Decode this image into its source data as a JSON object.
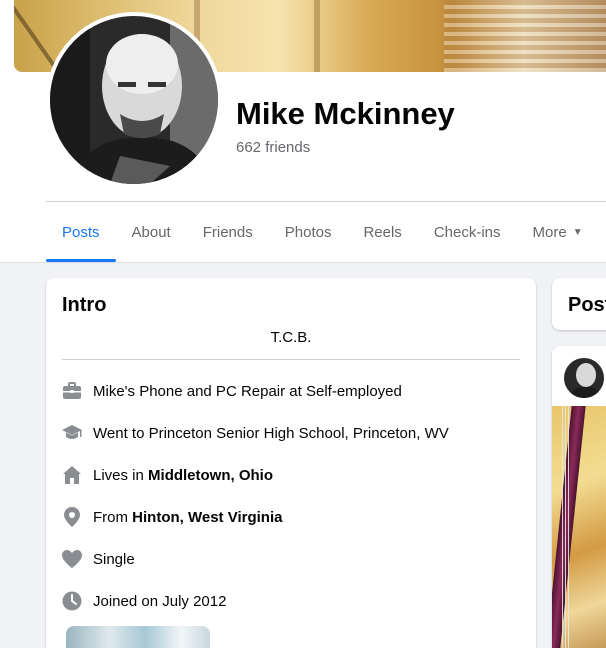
{
  "profile": {
    "name": "Mike Mckinney",
    "friends": "662 friends"
  },
  "tabs": [
    {
      "label": "Posts",
      "active": true
    },
    {
      "label": "About"
    },
    {
      "label": "Friends"
    },
    {
      "label": "Photos"
    },
    {
      "label": "Reels"
    },
    {
      "label": "Check-ins"
    },
    {
      "label": "More"
    }
  ],
  "intro": {
    "title": "Intro",
    "bio": "T.C.B.",
    "work": {
      "icon": "briefcase-icon",
      "text": "Mike's Phone and PC Repair at Self-employed"
    },
    "education": {
      "icon": "graduation-cap-icon",
      "text": "Went to Princeton Senior High School, Princeton, WV"
    },
    "lives": {
      "icon": "home-icon",
      "prefix": "Lives in ",
      "place": "Middletown, Ohio"
    },
    "from": {
      "icon": "location-pin-icon",
      "prefix": "From ",
      "place": "Hinton, West Virginia"
    },
    "relationship": {
      "icon": "heart-icon",
      "text": "Single"
    },
    "joined": {
      "icon": "clock-icon",
      "text": "Joined on July 2012"
    }
  },
  "posts_header": "Post",
  "colors": {
    "accent": "#1877f2",
    "secondary_text": "#65676b",
    "page_bg": "#f0f2f5",
    "icon_gray": "#8a8d91"
  }
}
